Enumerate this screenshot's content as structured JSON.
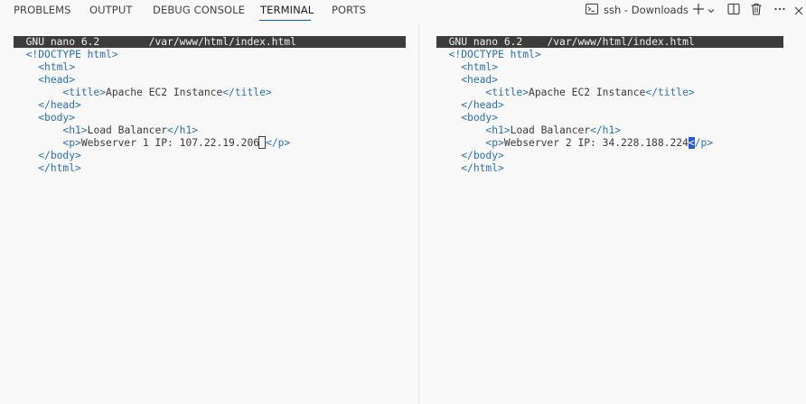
{
  "tabs": [
    {
      "label": "PROBLEMS"
    },
    {
      "label": "OUTPUT"
    },
    {
      "label": "DEBUG CONSOLE"
    },
    {
      "label": "TERMINAL"
    },
    {
      "label": "PORTS"
    }
  ],
  "active_tab": "TERMINAL",
  "terminal_selector": {
    "label": "ssh - Downloads"
  },
  "colors": {
    "accent": "#005fb8",
    "tag": "#2a6fb0",
    "nano_bar": "#3c3c3c",
    "cursor": "#1e5bd6"
  },
  "terminals": [
    {
      "header_left": "GNU nano 6.2",
      "header_right": "/var/www/html/index.html",
      "doctype": "<!DOCTYPE html>",
      "html_open": "<html>",
      "head_open": "<head>",
      "title_open": "<title>",
      "title_text": "Apache EC2 Instance",
      "title_close": "</title>",
      "head_close": "</head>",
      "body_open": "<body>",
      "h1_open": "<h1>",
      "h1_text": "Load Balancer",
      "h1_close": "</h1>",
      "p_open": "<p>",
      "p_text": "Webserver 1 IP: 107.22.19.206",
      "p_close": "</p>",
      "body_close": "</body>",
      "html_close": "</html>"
    },
    {
      "header_left": "GNU nano 6.2",
      "header_right": "/var/www/html/index.html",
      "doctype": "<!DOCTYPE html>",
      "html_open": "<html>",
      "head_open": "<head>",
      "title_open": "<title>",
      "title_text": "Apache EC2 Instance",
      "title_close": "</title>",
      "head_close": "</head>",
      "body_open": "<body>",
      "h1_open": "<h1>",
      "h1_text": "Load Balancer",
      "h1_close": "</h1>",
      "p_open": "<p>",
      "p_text": "Webserver 2 IP: 34.228.188.224",
      "p_close_cursor": "<",
      "p_close_rest": "/p>",
      "body_close": "</body>",
      "html_close": "</html>"
    }
  ]
}
